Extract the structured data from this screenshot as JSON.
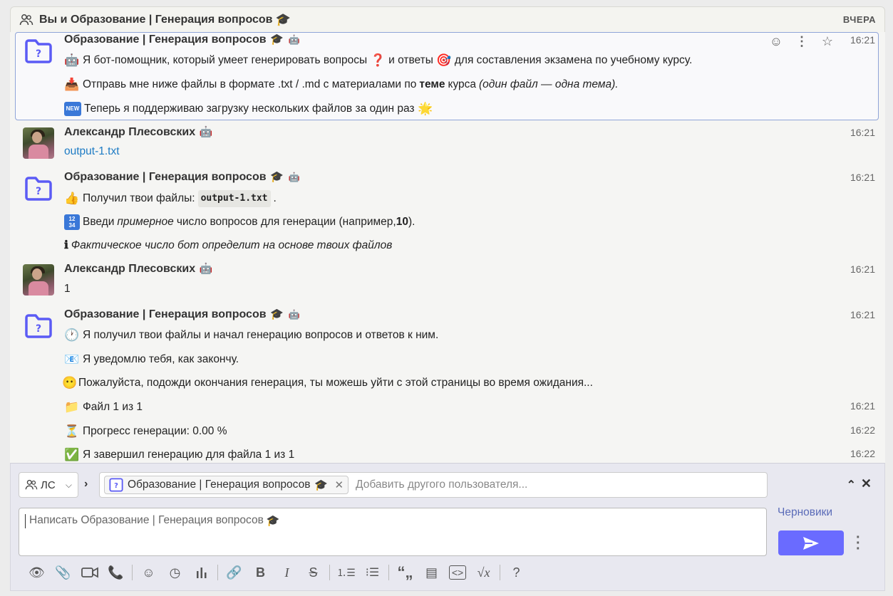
{
  "header": {
    "title": "Вы и Образование | Генерация вопросов",
    "title_emoji": "🎓",
    "date_label": "ВЧЕРА"
  },
  "messages": [
    {
      "sender": "Образование | Генерация вопросов",
      "time": "16:21",
      "lines": [
        {
          "a": "Я бот-помощник, который умеет генерировать вопросы",
          "b": "и ответы",
          "c": "для составления экзамена по учебному курсу."
        },
        {
          "a": "Отправь мне ниже файлы в формате .txt / .md с материалами по",
          "bold": "теме",
          "b": "курса",
          "italic": "(один файл — одна тема)."
        },
        {
          "a": "Теперь я поддерживаю загрузку нескольких файлов за один раз"
        }
      ]
    },
    {
      "sender": "Александр Плесовских",
      "time": "16:21",
      "file": "output-1.txt"
    },
    {
      "sender": "Образование | Генерация вопросов",
      "time": "16:21",
      "lines": [
        {
          "a": "Получил твои файлы:",
          "code": "output-1.txt",
          "b": "."
        },
        {
          "a": "Введи",
          "italic": "примерное",
          "b": "число вопросов для генерации (например,",
          "bold": "10",
          "c": ")."
        },
        {
          "icon": "ℹ",
          "italic": "Фактическое число бот определит на основе твоих файлов"
        }
      ]
    },
    {
      "sender": "Александр Плесовских",
      "time": "16:21",
      "text": "1"
    },
    {
      "sender": "Образование | Генерация вопросов",
      "time": "16:21",
      "lines": [
        {
          "a": "Я получил твои файлы и начал генерацию вопросов и ответов к ним."
        },
        {
          "a": "Я уведомлю тебя, как закончу."
        },
        {
          "a": "Пожалуйста, подожди окончания генерация, ты можешь уйти с этой страницы во время ожидания..."
        },
        {
          "a": "Файл 1 из 1",
          "time": "16:21"
        },
        {
          "a": "Прогресс генерации: 0.00 %",
          "time": "16:22"
        },
        {
          "a": "Я завершил генерацию для файла 1 из 1",
          "time": "16:22"
        }
      ]
    }
  ],
  "compose": {
    "scope_label": "ЛС",
    "recipient": "Образование | Генерация вопросов",
    "recipient_emoji": "🎓",
    "add_placeholder": "Добавить другого пользователя...",
    "message_placeholder": "Написать Образование | Генерация вопросов",
    "drafts_label": "Черновики",
    "help_label": "?"
  },
  "colors": {
    "accent": "#6a6bff",
    "link": "#1d7bc4",
    "highlight_border": "#8fa4d8",
    "bot_icon": "#5b5bf5"
  }
}
